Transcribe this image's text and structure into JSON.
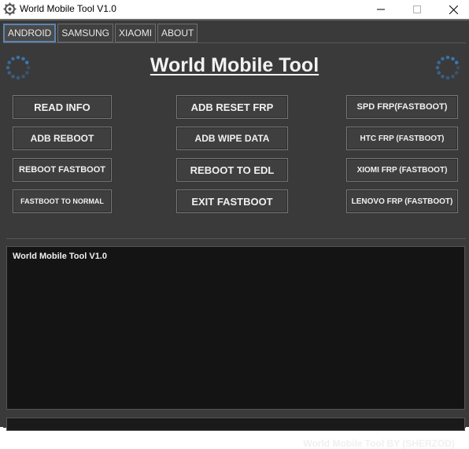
{
  "window": {
    "title": "World Mobile Tool V1.0"
  },
  "tabs": [
    {
      "label": "ANDROID"
    },
    {
      "label": "SAMSUNG"
    },
    {
      "label": "XIAOMI"
    },
    {
      "label": "ABOUT"
    }
  ],
  "header": {
    "title": "World Mobile Tool"
  },
  "buttons": {
    "col1": [
      "READ INFO",
      "ADB REBOOT",
      "REBOOT FASTBOOT",
      "FASTBOOT TO NORMAL"
    ],
    "col2": [
      "ADB RESET FRP",
      "ADB WIPE DATA",
      "REBOOT TO EDL",
      "EXIT FASTBOOT"
    ],
    "col3": [
      "SPD FRP(FASTBOOT)",
      "HTC FRP (FASTBOOT)",
      "XIOMI FRP (FASTBOOT)",
      "LENOVO FRP (FASTBOOT)"
    ]
  },
  "log": {
    "text": "World Mobile Tool V1.0"
  },
  "footer": {
    "text": "World Mobile Tool BY (SHERZOD)"
  },
  "colors": {
    "background": "#3a3a3a",
    "log_background": "#141414",
    "active_tab_border": "#5c86b0",
    "spinner": "#3c78b4"
  },
  "icons": {
    "app": "gear-icon",
    "loading": "spinner-icon"
  }
}
